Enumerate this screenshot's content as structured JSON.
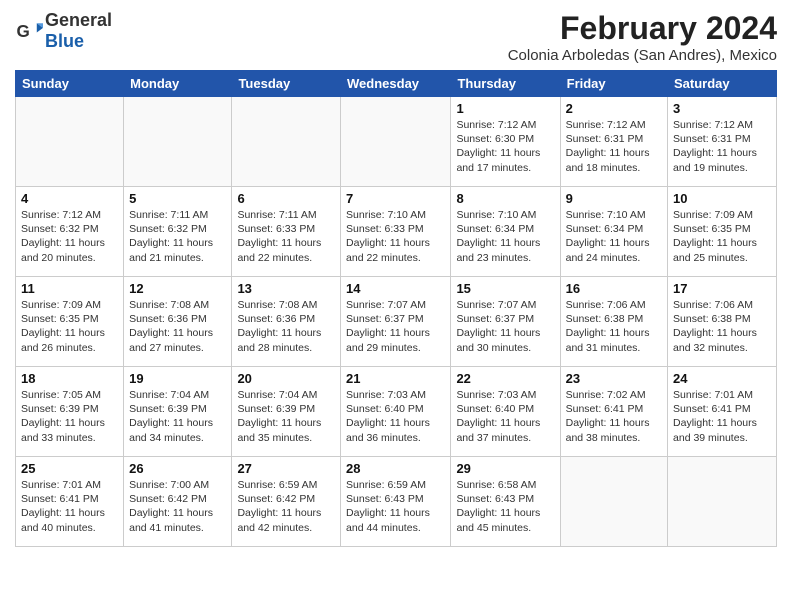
{
  "header": {
    "logo_general": "General",
    "logo_blue": "Blue",
    "main_title": "February 2024",
    "sub_title": "Colonia Arboledas (San Andres), Mexico"
  },
  "days_of_week": [
    "Sunday",
    "Monday",
    "Tuesday",
    "Wednesday",
    "Thursday",
    "Friday",
    "Saturday"
  ],
  "weeks": [
    [
      {
        "day": "",
        "info": ""
      },
      {
        "day": "",
        "info": ""
      },
      {
        "day": "",
        "info": ""
      },
      {
        "day": "",
        "info": ""
      },
      {
        "day": "1",
        "info": "Sunrise: 7:12 AM\nSunset: 6:30 PM\nDaylight: 11 hours\nand 17 minutes."
      },
      {
        "day": "2",
        "info": "Sunrise: 7:12 AM\nSunset: 6:31 PM\nDaylight: 11 hours\nand 18 minutes."
      },
      {
        "day": "3",
        "info": "Sunrise: 7:12 AM\nSunset: 6:31 PM\nDaylight: 11 hours\nand 19 minutes."
      }
    ],
    [
      {
        "day": "4",
        "info": "Sunrise: 7:12 AM\nSunset: 6:32 PM\nDaylight: 11 hours\nand 20 minutes."
      },
      {
        "day": "5",
        "info": "Sunrise: 7:11 AM\nSunset: 6:32 PM\nDaylight: 11 hours\nand 21 minutes."
      },
      {
        "day": "6",
        "info": "Sunrise: 7:11 AM\nSunset: 6:33 PM\nDaylight: 11 hours\nand 22 minutes."
      },
      {
        "day": "7",
        "info": "Sunrise: 7:10 AM\nSunset: 6:33 PM\nDaylight: 11 hours\nand 22 minutes."
      },
      {
        "day": "8",
        "info": "Sunrise: 7:10 AM\nSunset: 6:34 PM\nDaylight: 11 hours\nand 23 minutes."
      },
      {
        "day": "9",
        "info": "Sunrise: 7:10 AM\nSunset: 6:34 PM\nDaylight: 11 hours\nand 24 minutes."
      },
      {
        "day": "10",
        "info": "Sunrise: 7:09 AM\nSunset: 6:35 PM\nDaylight: 11 hours\nand 25 minutes."
      }
    ],
    [
      {
        "day": "11",
        "info": "Sunrise: 7:09 AM\nSunset: 6:35 PM\nDaylight: 11 hours\nand 26 minutes."
      },
      {
        "day": "12",
        "info": "Sunrise: 7:08 AM\nSunset: 6:36 PM\nDaylight: 11 hours\nand 27 minutes."
      },
      {
        "day": "13",
        "info": "Sunrise: 7:08 AM\nSunset: 6:36 PM\nDaylight: 11 hours\nand 28 minutes."
      },
      {
        "day": "14",
        "info": "Sunrise: 7:07 AM\nSunset: 6:37 PM\nDaylight: 11 hours\nand 29 minutes."
      },
      {
        "day": "15",
        "info": "Sunrise: 7:07 AM\nSunset: 6:37 PM\nDaylight: 11 hours\nand 30 minutes."
      },
      {
        "day": "16",
        "info": "Sunrise: 7:06 AM\nSunset: 6:38 PM\nDaylight: 11 hours\nand 31 minutes."
      },
      {
        "day": "17",
        "info": "Sunrise: 7:06 AM\nSunset: 6:38 PM\nDaylight: 11 hours\nand 32 minutes."
      }
    ],
    [
      {
        "day": "18",
        "info": "Sunrise: 7:05 AM\nSunset: 6:39 PM\nDaylight: 11 hours\nand 33 minutes."
      },
      {
        "day": "19",
        "info": "Sunrise: 7:04 AM\nSunset: 6:39 PM\nDaylight: 11 hours\nand 34 minutes."
      },
      {
        "day": "20",
        "info": "Sunrise: 7:04 AM\nSunset: 6:39 PM\nDaylight: 11 hours\nand 35 minutes."
      },
      {
        "day": "21",
        "info": "Sunrise: 7:03 AM\nSunset: 6:40 PM\nDaylight: 11 hours\nand 36 minutes."
      },
      {
        "day": "22",
        "info": "Sunrise: 7:03 AM\nSunset: 6:40 PM\nDaylight: 11 hours\nand 37 minutes."
      },
      {
        "day": "23",
        "info": "Sunrise: 7:02 AM\nSunset: 6:41 PM\nDaylight: 11 hours\nand 38 minutes."
      },
      {
        "day": "24",
        "info": "Sunrise: 7:01 AM\nSunset: 6:41 PM\nDaylight: 11 hours\nand 39 minutes."
      }
    ],
    [
      {
        "day": "25",
        "info": "Sunrise: 7:01 AM\nSunset: 6:41 PM\nDaylight: 11 hours\nand 40 minutes."
      },
      {
        "day": "26",
        "info": "Sunrise: 7:00 AM\nSunset: 6:42 PM\nDaylight: 11 hours\nand 41 minutes."
      },
      {
        "day": "27",
        "info": "Sunrise: 6:59 AM\nSunset: 6:42 PM\nDaylight: 11 hours\nand 42 minutes."
      },
      {
        "day": "28",
        "info": "Sunrise: 6:59 AM\nSunset: 6:43 PM\nDaylight: 11 hours\nand 44 minutes."
      },
      {
        "day": "29",
        "info": "Sunrise: 6:58 AM\nSunset: 6:43 PM\nDaylight: 11 hours\nand 45 minutes."
      },
      {
        "day": "",
        "info": ""
      },
      {
        "day": "",
        "info": ""
      }
    ]
  ]
}
